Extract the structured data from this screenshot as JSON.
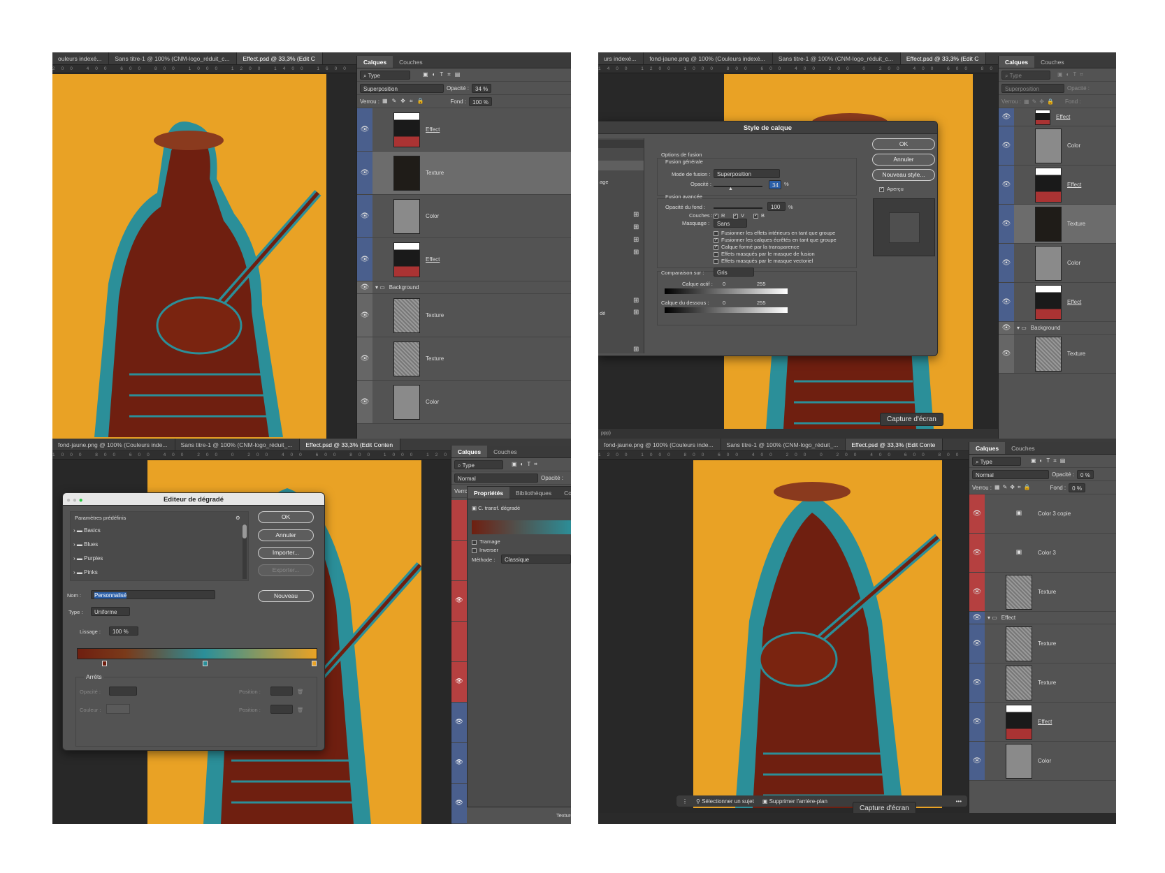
{
  "colors": {
    "orange": "#e9a225",
    "teal": "#2b8f99",
    "maroon": "#6f1f10",
    "panel": "#535353"
  },
  "q1": {
    "tabs": [
      "ouleurs indexé...",
      "Sans titre-1 @ 100% (CNM-logo_réduit_c...",
      "Effect.psd @ 33,3% (Edit C"
    ],
    "ruler": "200 400 600 800 1000 1200 1400 1600 1800 2000 2200 2400 2600 2800 3000 320",
    "panel_tabs": [
      "Calques",
      "Couches"
    ],
    "filter": "Type",
    "blend": "Superposition",
    "opacity_label": "Opacité :",
    "opacity": "34 %",
    "lock_label": "Verrou :",
    "fill_label": "Fond :",
    "fill": "100 %",
    "layers": [
      {
        "name": "Effect",
        "thumb": "fig",
        "eye": "blue",
        "u": true
      },
      {
        "name": "Texture",
        "thumb": "dark",
        "eye": "blue",
        "hl": true
      },
      {
        "name": "Color",
        "thumb": "gray",
        "eye": "blue"
      },
      {
        "name": "Effect",
        "thumb": "fig",
        "eye": "blue",
        "u": true
      }
    ],
    "group": "Background",
    "layers2": [
      {
        "name": "Texture",
        "thumb": "tex",
        "eye": "grey"
      },
      {
        "name": "Texture",
        "thumb": "tex",
        "eye": "grey"
      },
      {
        "name": "Color",
        "thumb": "gray",
        "eye": "grey"
      }
    ]
  },
  "q2": {
    "tabs": [
      "urs indexé...",
      "fond-jaune.png @ 100% (Couleurs indexé...",
      "Sans titre-1 @ 100% (CNM-logo_réduit_c...",
      "Effect.psd @ 33,3% (Edit C"
    ],
    "ruler": "1400 1200 1000 800 600 400 200 0 200 400 600 800 1000 1200 1400 1600 1800 2000 2200 2400",
    "panel_tabs": [
      "Calques",
      "Couches"
    ],
    "filter": "Type",
    "blend": "Superposition",
    "opacity_label": "Opacité :",
    "opacity": "34",
    "lock_label": "Verrou :",
    "fill_label": "Fond :",
    "fill": "100",
    "layers": [
      {
        "name": "Effect",
        "thumb": "fig",
        "eye": "blue",
        "u": true,
        "h": 26
      },
      {
        "name": "Color",
        "thumb": "gray",
        "eye": "blue",
        "h": 56
      },
      {
        "name": "Effect",
        "thumb": "fig",
        "eye": "blue",
        "u": true,
        "h": 56
      },
      {
        "name": "Texture",
        "thumb": "dark",
        "eye": "blue",
        "hl": true,
        "h": 56
      },
      {
        "name": "Color",
        "thumb": "gray",
        "eye": "blue",
        "h": 56
      },
      {
        "name": "Effect",
        "thumb": "fig",
        "eye": "blue",
        "u": true,
        "h": 56
      }
    ],
    "group": "Background",
    "layers2": [
      {
        "name": "Texture",
        "thumb": "tex",
        "eye": "grey",
        "h": 56
      }
    ],
    "dialog": {
      "title": "Style de calque",
      "sidebar": [
        "age",
        "dé"
      ],
      "options": "Options de fusion",
      "general": "Fusion générale",
      "mode_label": "Mode de fusion :",
      "mode": "Superposition",
      "opacity_label": "Opacité :",
      "opacity": "34",
      "pct": "%",
      "advanced": "Fusion avancée",
      "fill_label": "Opacité du fond :",
      "fill": "100",
      "channels_label": "Couches :",
      "ch": [
        "R",
        "V",
        "B"
      ],
      "knockout_label": "Masquage :",
      "knockout": "Sans",
      "checks": [
        {
          "t": "Fusionner les effets intérieurs en tant que groupe",
          "c": false
        },
        {
          "t": "Fusionner les calques écrêtés en tant que groupe",
          "c": true
        },
        {
          "t": "Calque formé par la transparence",
          "c": true
        },
        {
          "t": "Effets masqués par le masque de fusion",
          "c": false
        },
        {
          "t": "Effets masqués par le masque vectoriel",
          "c": false
        }
      ],
      "blendif_label": "Comparaison sur :",
      "blendif": "Gris",
      "this_layer": "Calque actif :",
      "under_layer": "Calque du dessous :",
      "v0": "0",
      "v255": "255",
      "ok": "OK",
      "cancel": "Annuler",
      "new_style": "Nouveau style...",
      "preview": "Aperçu"
    },
    "tooltip": "Capture d'écran",
    "status": "ppp)"
  },
  "q3": {
    "tabs": [
      "fond-jaune.png @ 100% (Couleurs inde...",
      "Sans titre-1 @ 100% (CNM-logo_réduit_...",
      "Effect.psd @ 33,3% (Edit Conten"
    ],
    "ruler": "1000 800 600 400 200 0 200 400 600 800 1000 1200 1400 1600 1800 2000 2200 2400 2600 2800 3000 3200",
    "panel_tabs": [
      "Calques",
      "Couches"
    ],
    "filter": "Type",
    "blend": "Normal",
    "opacity_label": "Opacité :",
    "lock_label": "Verro",
    "props_tabs": [
      "Propriétés",
      "Bibliothèques",
      "Co"
    ],
    "props_item": "C. transf. dégradé",
    "dither": "Tramage",
    "reverse": "Inverser",
    "method_label": "Méthode :",
    "method": "Classique",
    "bottom_layer": "Texture",
    "dialog": {
      "title": "Editeur de dégradé",
      "presets": "Paramètres prédéfinis",
      "folders": [
        "Basics",
        "Blues",
        "Purples",
        "Pinks"
      ],
      "ok": "OK",
      "cancel": "Annuler",
      "import": "Importer...",
      "export": "Exporter...",
      "name_label": "Nom :",
      "name": "Personnalisé",
      "new": "Nouveau",
      "type_label": "Type :",
      "type": "Uniforme",
      "smooth_label": "Lissage :",
      "smooth": "100 %",
      "stops": "Arrêts",
      "opacity_label": "Opacité :",
      "position_label": "Position :",
      "color_label": "Couleur :"
    },
    "side_strip": [
      "red",
      "red",
      "eye-red",
      "red",
      "eye-red",
      "eye-blue",
      "eye-blue",
      "eye-blue"
    ]
  },
  "q4": {
    "tabs": [
      "fond-jaune.png @ 100% (Couleurs inde...",
      "Sans titre-1 @ 100% (CNM-logo_réduit_...",
      "Effect.psd @ 33,3% (Edit Conte"
    ],
    "ruler": "1200 1000 800 600 400 200 0 200 400 600 800 1000 1200 1400 1600 1800 2000 2200 2400 2600 2800 3000",
    "panel_tabs": [
      "Calques",
      "Couches"
    ],
    "filter": "Type",
    "blend": "Normal",
    "opacity_label": "Opacité :",
    "opacity": "0 %",
    "lock_label": "Verrou :",
    "fill_label": "Fond :",
    "fill": "0 %",
    "layers": [
      {
        "name": "Color 3 copie",
        "thumb": "none",
        "eye": "red",
        "h": 56
      },
      {
        "name": "Color 3",
        "thumb": "none",
        "eye": "red",
        "h": 56
      },
      {
        "name": "Texture",
        "thumb": "tex",
        "eye": "red",
        "h": 56
      }
    ],
    "group": "Effect",
    "layers2": [
      {
        "name": "Texture",
        "thumb": "tex",
        "eye": "blue",
        "h": 56
      },
      {
        "name": "Texture",
        "thumb": "tex",
        "eye": "blue",
        "h": 56
      },
      {
        "name": "Effect",
        "thumb": "fig",
        "eye": "blue",
        "u": true,
        "h": 56
      },
      {
        "name": "Color",
        "thumb": "gray",
        "eye": "blue",
        "h": 56
      }
    ],
    "taskbar": {
      "select_subject": "Sélectionner un sujet",
      "remove_bg": "Supprimer l'arrière-plan"
    },
    "tooltip": "Capture d'écran"
  }
}
